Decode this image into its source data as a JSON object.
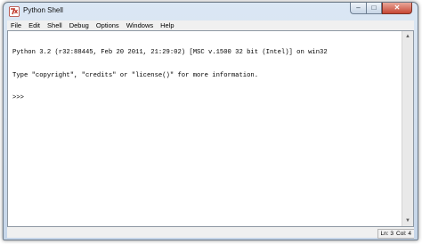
{
  "window": {
    "title": "Python Shell",
    "caption_buttons": {
      "minimize": "–",
      "maximize": "□",
      "close": "✕"
    }
  },
  "menu": [
    "File",
    "Edit",
    "Shell",
    "Debug",
    "Options",
    "Windows",
    "Help"
  ],
  "shell": {
    "lines": [
      "Python 3.2 (r32:88445, Feb 20 2011, 21:29:02) [MSC v.1500 32 bit (Intel)] on win32",
      "Type \"copyright\", \"credits\" or \"license()\" for more information.",
      ">>> "
    ]
  },
  "status": {
    "line": "Ln: 3",
    "col": "Col: 4"
  },
  "colors": {
    "accent": "#c74735",
    "frame": "#c6d6e9"
  },
  "icons": {
    "app": "python-idle-icon",
    "scroll_up": "arrow-up-icon",
    "scroll_down": "arrow-down-icon"
  }
}
